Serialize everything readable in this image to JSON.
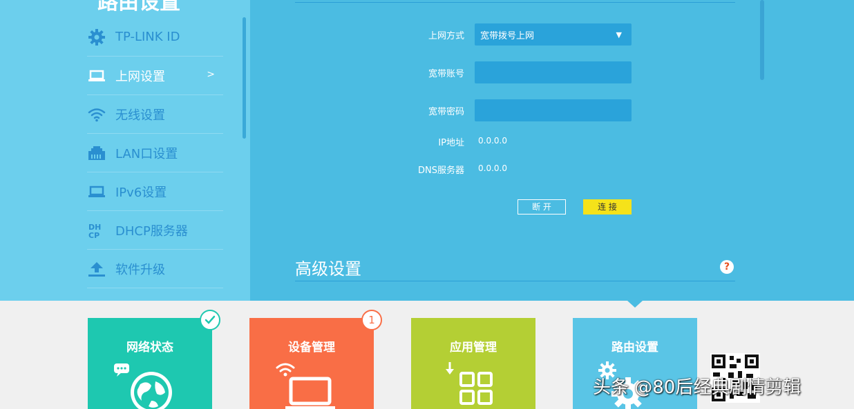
{
  "sidebar": {
    "title": "路由设置",
    "items": [
      {
        "label": "TP-LINK ID",
        "icon": "gear-icon"
      },
      {
        "label": "上网设置",
        "icon": "laptop-icon",
        "chevron": ">"
      },
      {
        "label": "无线设置",
        "icon": "wifi-icon"
      },
      {
        "label": "LAN口设置",
        "icon": "lan-port-icon"
      },
      {
        "label": "IPv6设置",
        "icon": "laptop-icon"
      },
      {
        "label": "DHCP服务器",
        "icon": "dhcp-icon"
      },
      {
        "label": "软件升级",
        "icon": "upload-icon"
      }
    ]
  },
  "form": {
    "mode_label": "上网方式",
    "mode_value": "宽带拨号上网",
    "account_label": "宽带账号",
    "account_value": "",
    "password_label": "宽带密码",
    "password_value": "",
    "ip_label": "IP地址",
    "ip_value": "0.0.0.0",
    "dns_label": "DNS服务器",
    "dns_value": "0.0.0.0",
    "disconnect_label": "断 开",
    "connect_label": "连 接"
  },
  "advanced": {
    "title": "高级设置",
    "help": "?"
  },
  "tiles": [
    {
      "label": "网络状态",
      "color": "#1ec8b0",
      "badge": "check"
    },
    {
      "label": "设备管理",
      "color": "#f96e46",
      "badge": "1"
    },
    {
      "label": "应用管理",
      "color": "#b4cf34",
      "badge": ""
    },
    {
      "label": "路由设置",
      "color": "#5ac5e6",
      "badge": ""
    }
  ],
  "watermark": "头条 @80后经典剧情剪辑",
  "colors": {
    "sidebar_bg": "#6ccfed",
    "main_bg": "#4bbce2",
    "field_bg": "#2aa3da",
    "connect_btn": "#f5e21a",
    "help_red": "#e8501e"
  }
}
